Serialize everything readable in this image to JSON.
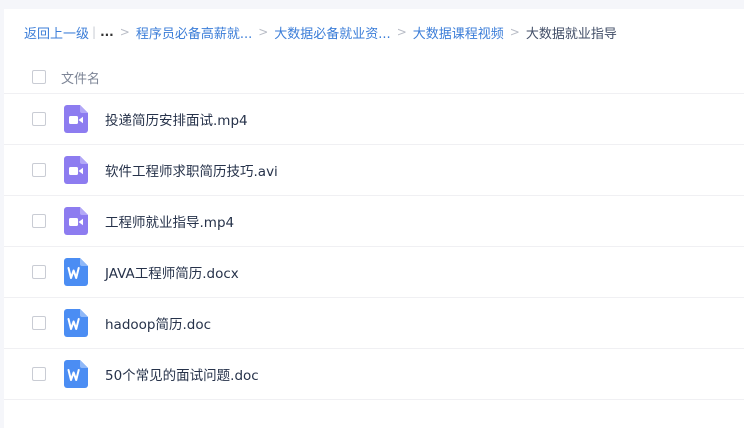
{
  "breadcrumb": {
    "back_label": "返回上一级",
    "ellipsis": "...",
    "items": [
      {
        "label": "程序员必备高薪就..."
      },
      {
        "label": "大数据必备就业资..."
      },
      {
        "label": "大数据课程视频"
      }
    ],
    "current": "大数据就业指导"
  },
  "list_header": {
    "column_label": "文件名"
  },
  "files": [
    {
      "name": "投递简历安排面试.mp4",
      "icon": "video-file-icon"
    },
    {
      "name": "软件工程师求职简历技巧.avi",
      "icon": "video-file-icon"
    },
    {
      "name": "工程师就业指导.mp4",
      "icon": "video-file-icon"
    },
    {
      "name": "JAVA工程师简历.docx",
      "icon": "word-file-icon"
    },
    {
      "name": "hadoop简历.doc",
      "icon": "word-file-icon"
    },
    {
      "name": "50个常见的面试问题.doc",
      "icon": "word-file-icon"
    }
  ],
  "colors": {
    "video_icon": "#8d7cf0",
    "word_icon": "#4b8df3",
    "link": "#3b7dd8"
  }
}
